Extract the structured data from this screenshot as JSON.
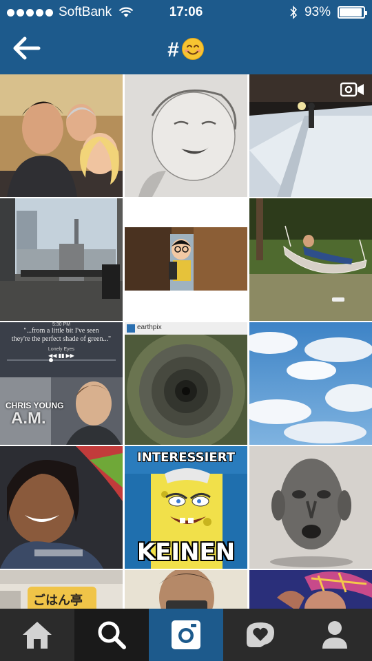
{
  "status_bar": {
    "carrier": "SoftBank",
    "time": "17:06",
    "battery_percent": "93%",
    "battery_level": 0.93
  },
  "nav": {
    "title_prefix": "#",
    "title_emoji": "smiling-face-emoji"
  },
  "grid": {
    "music_card": {
      "time": "5:30 PM",
      "quote_line1": "\"...from a little bit I've seen",
      "quote_line2": "they're the perfect shade of green...\"",
      "song": "Lonely Eyes",
      "artist_label": "CHRIS YOUNG",
      "album_label": "A.M."
    },
    "earthpix_label": "earthpix",
    "meme_top": "INTERESSIERT",
    "meme_bottom": "KEINEN",
    "sign_text": "ごはん亭"
  },
  "tabbar": {
    "items": [
      {
        "name": "home-icon"
      },
      {
        "name": "search-icon"
      },
      {
        "name": "camera-icon"
      },
      {
        "name": "activity-heart-icon"
      },
      {
        "name": "profile-icon"
      }
    ],
    "active_colors": {
      "search": "#1a1a1a",
      "camera": "#1d5a8c"
    }
  },
  "colors": {
    "header_bg": "#1d5a8c",
    "tabbar_bg": "#2b2b2b"
  }
}
